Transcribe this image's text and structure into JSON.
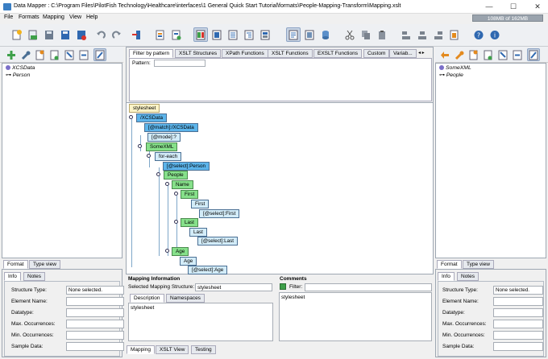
{
  "window": {
    "title": "Data Mapper : C:\\Program Files\\PilotFish Technology\\Healthcare\\interfaces\\1 General Quick Start Tutorial\\formats\\People-Mapping-Transform\\Mapping.xslt",
    "minimize": "—",
    "maximize": "☐",
    "close": "✕"
  },
  "menu": [
    "File",
    "Formats",
    "Mapping",
    "View",
    "Help"
  ],
  "memory": "108MB of 162MB",
  "left": {
    "tree": [
      {
        "label": "XCSData"
      },
      {
        "label": "Person"
      }
    ],
    "tabs": [
      "Format",
      "Type view"
    ],
    "info_tabs": [
      "Info",
      "Notes"
    ]
  },
  "right": {
    "tree": [
      {
        "label": "SomeXML"
      },
      {
        "label": "People"
      }
    ],
    "tabs": [
      "Format",
      "Type view"
    ],
    "info_tabs": [
      "Info",
      "Notes"
    ]
  },
  "fields": {
    "labels": [
      "Structure Type:",
      "Element Name:",
      "Datatype:",
      "Max. Occurrences:",
      "Min. Occurrences:",
      "Sample Data:"
    ],
    "left_values": [
      "None selected.",
      "",
      "",
      "",
      "",
      ""
    ],
    "right_values": [
      "None selected.",
      "",
      "",
      "",
      "",
      ""
    ]
  },
  "center": {
    "func_tabs": [
      "Filter by pattern",
      "XSLT Structures",
      "XPath Functions",
      "XSLT Functions",
      "EXSLT Functions",
      "Custom",
      "Variab..."
    ],
    "pattern_label": "Pattern:",
    "pattern_value": "",
    "bottom_tabs": [
      "Mapping",
      "XSLT View",
      "Testing"
    ]
  },
  "mapping": {
    "nodes": [
      "stylesheet",
      "/XCSData",
      "[@match]:/XCSData",
      "[@mode]:?",
      "SomeXML",
      "for-each",
      "[@select]:Person",
      "People",
      "Name",
      "First",
      "First",
      "[@select]:First",
      "Last",
      "Last",
      "[@select]:Last",
      "Age",
      "Age",
      "[@select]:Age"
    ]
  },
  "mapping_info": {
    "title": "Mapping Information",
    "label": "Selected Mapping Structure:",
    "value": "stylesheet",
    "tabs": [
      "Description",
      "Namespaces"
    ],
    "description": "stylesheet"
  },
  "comments": {
    "title": "Comments",
    "filter_label": "Filter:",
    "filter_value": "",
    "item": "stylesheet"
  }
}
